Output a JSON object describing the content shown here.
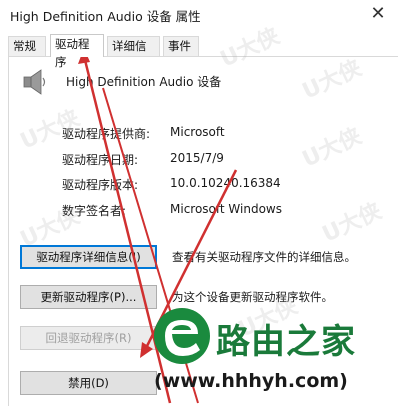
{
  "window": {
    "title": "High Definition Audio 设备 属性",
    "close_glyph": "✕"
  },
  "tabs": [
    {
      "label": "常规",
      "active": false
    },
    {
      "label": "驱动程序",
      "active": true
    },
    {
      "label": "详细信息",
      "active": false
    },
    {
      "label": "事件",
      "active": false
    }
  ],
  "device": {
    "name": "High Definition Audio 设备",
    "icon": "speaker-icon"
  },
  "info": [
    {
      "label": "驱动程序提供商:",
      "value": "Microsoft"
    },
    {
      "label": "驱动程序日期:",
      "value": "2015/7/9"
    },
    {
      "label": "驱动程序版本:",
      "value": "10.0.10240.16384"
    },
    {
      "label": "数字签名者:",
      "value": "Microsoft Windows"
    }
  ],
  "buttons": [
    {
      "label": "驱动程序详细信息(I)",
      "desc": "查看有关驱动程序文件的详细信息。",
      "state": "focused"
    },
    {
      "label": "更新驱动程序(P)...",
      "desc": "为这个设备更新驱动程序软件。",
      "state": "normal"
    },
    {
      "label": "回退驱动程序(R)",
      "desc": "",
      "state": "disabled"
    },
    {
      "label": "禁用(D)",
      "desc": "",
      "state": "normal"
    }
  ],
  "watermark": {
    "brand": "U大侠",
    "logo_text": "路由之家",
    "logo_url": "(www.hhhyh.com)",
    "logo_color": "#1a7a3a",
    "arrow_color": "#d03030"
  }
}
